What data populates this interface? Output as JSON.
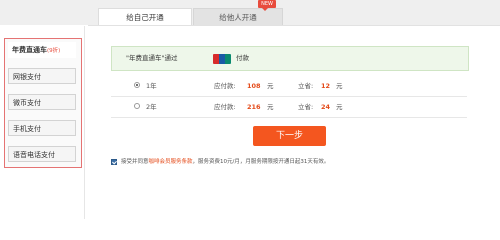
{
  "tabs": {
    "active": "给自己开通",
    "inactive": "给他人开通",
    "badge": "NEW"
  },
  "sidebar": {
    "items": [
      {
        "label": "年费直通车",
        "tag": "(9折)"
      },
      {
        "label": "网银支付"
      },
      {
        "label": "微币支付"
      },
      {
        "label": "手机支付"
      },
      {
        "label": "语音电话支付"
      }
    ]
  },
  "main": {
    "intro_text": "\"年费直通车\"通过",
    "pay_label": "付款",
    "plans": [
      {
        "duration": "1年",
        "pay_label": "应付款:",
        "pay_amount": "108",
        "unit": "元",
        "save_label": "立省:",
        "save_amount": "12",
        "save_unit": "元",
        "selected": true
      },
      {
        "duration": "2年",
        "pay_label": "应付款:",
        "pay_amount": "216",
        "unit": "元",
        "save_label": "立省:",
        "save_amount": "24",
        "save_unit": "元",
        "selected": false
      }
    ],
    "next_button": "下一步",
    "agree": {
      "prefix": "接受并同意",
      "link": "咖啡会员服务条款",
      "suffix": "，服务资费10元/月，月服务期限按开通日起31天有效。"
    }
  },
  "colors": {
    "accent": "#f4561f",
    "price_red": "#e44b1a",
    "sidebar_border": "#e57373"
  }
}
